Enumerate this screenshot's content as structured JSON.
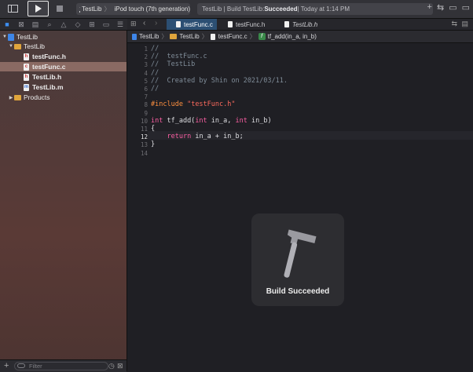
{
  "toolbar": {
    "scheme_target": "TestLib",
    "scheme_device": "iPod touch (7th generation)",
    "status_prefix": "TestLib | Build TestLib: ",
    "status_result": "Succeeded",
    "status_time": " | Today at 1:14 PM"
  },
  "navigator": {
    "items": [
      {
        "label": "TestLib",
        "kind": "project"
      },
      {
        "label": "TestLib",
        "kind": "folder"
      },
      {
        "label": "testFunc.h",
        "kind": "h"
      },
      {
        "label": "testFunc.c",
        "kind": "c",
        "selected": true
      },
      {
        "label": "TestLib.h",
        "kind": "h"
      },
      {
        "label": "TestLib.m",
        "kind": "m"
      },
      {
        "label": "Products",
        "kind": "folder"
      }
    ],
    "filter_placeholder": "Filter"
  },
  "tabs": [
    {
      "label": "testFunc.c",
      "active": true
    },
    {
      "label": "testFunc.h",
      "active": false
    },
    {
      "label": "TestLib.h",
      "active": false,
      "italic": true
    }
  ],
  "jumpbar": {
    "items": [
      "TestLib",
      "TestLib",
      "testFunc.c",
      "tf_add(in_a, in_b)"
    ]
  },
  "editor": {
    "current_line": 12,
    "lines": [
      "//",
      "//  testFunc.c",
      "//  TestLib",
      "//",
      "//  Created by Shin on 2021/03/11.",
      "//",
      "",
      "#include \"testFunc.h\"",
      "",
      "int tf_add(int in_a, int in_b)",
      "{",
      "    return in_a + in_b;",
      "}",
      ""
    ]
  },
  "hud": {
    "label": "Build Succeeded",
    "icon": "hammer-icon"
  },
  "colors": {
    "accent": "#3d8ef0",
    "keyword": "#fc5fa3",
    "comment": "#7f8c98",
    "string": "#fc6a5d",
    "preprocessor": "#fd8f3f"
  }
}
